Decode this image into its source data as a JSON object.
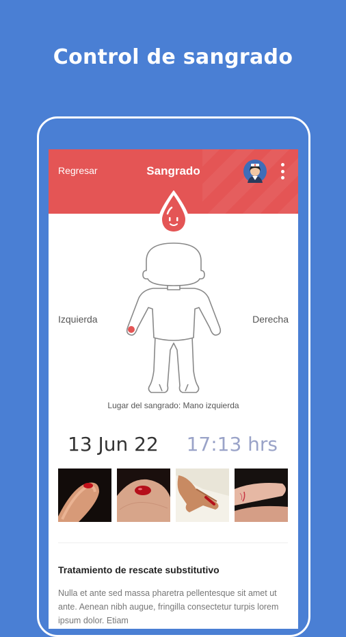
{
  "headline": "Control de sangrado",
  "appbar": {
    "back_label": "Regresar",
    "title": "Sangrado",
    "avatar_icon": "nurse-avatar-icon",
    "menu_icon": "more-vertical-icon",
    "color": "#e45555"
  },
  "body_map": {
    "left_label": "Izquierda",
    "right_label": "Derecha",
    "location_text": "Lugar del sangrado: Mano izquierda",
    "marker_color": "#e45555"
  },
  "record": {
    "date": "13 Jun 22",
    "time": "17:13 hrs"
  },
  "photos": [
    "finger-tip-blood-photo",
    "skin-blood-drop-photo",
    "cut-finger-photo",
    "finger-wound-photo"
  ],
  "treatment": {
    "title": "Tratamiento de rescate substitutivo",
    "text": "Nulla et ante sed massa pharetra pellentesque sit amet ut ante. Aenean nibh augue, fringilla consectetur turpis lorem ipsum dolor. Etiam"
  },
  "colors": {
    "background": "#4a7fd4",
    "accent": "#e45555",
    "time": "#9aa3c8"
  }
}
